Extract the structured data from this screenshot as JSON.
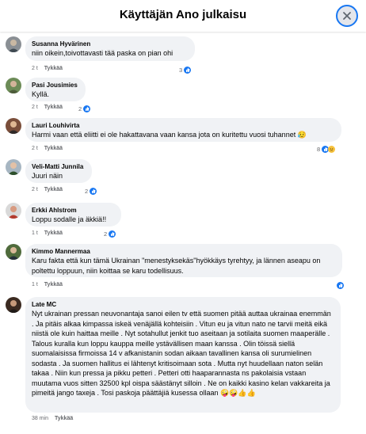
{
  "header": {
    "title": "Käyttäjän Ano julkaisu"
  },
  "comments": [
    {
      "author": "Susanna Hyvärinen",
      "text": "niin oikein,toivottavasti tää paska on pian ohi",
      "time": "2 t",
      "like": "Tykkää",
      "reactions": "3"
    },
    {
      "author": "Pasi Jousimies",
      "text": "Kyllä.",
      "time": "2 t",
      "like": "Tykkää",
      "reactions": "2"
    },
    {
      "author": "Lauri Louhivirta",
      "text": "Harmi vaan että eliitti ei ole hakattavana vaan kansa jota on kuritettu vuosi tuhannet 😥",
      "time": "2 t",
      "like": "Tykkää",
      "reactions": "8"
    },
    {
      "author": "Veli-Matti Junnila",
      "text": "Juuri näin",
      "time": "2 t",
      "like": "Tykkää",
      "reactions": "2"
    },
    {
      "author": "Erkki Ahlstrom",
      "text": "Loppu sodalle ja äkkiä!!",
      "time": "1 t",
      "like": "Tykkää",
      "reactions": "2"
    },
    {
      "author": "Kimmo Mannermaa",
      "text": "Karu fakta että kun tämä Ukrainan \"menestyksekäs\"hyökkäys tyrehtyy, ja lännen aseapu on poltettu loppuun, niin koittaa se karu todellisuus.",
      "time": "1 t",
      "like": "Tykkää",
      "reactions": ""
    },
    {
      "author": "Late MC",
      "text": "Nyt ukrainan pressan neuvonantaja sanoi eilen tv että suomen pitää auttaa ukrainaa enemmän . Ja pitäis alkaa kimpassa iskeä venäjällä kohteisiin . Vitun eu ja vitun nato ne tarvii meitä eikä niistä ole kuin haittaa meille . Nyt sotahullut jenkit tuo aseitaan ja sotilaita suomen maaperälle . Talous kuralla kun loppu kauppa meille ystävällisen maan kanssa . Olin töissä siellä suomalaisissa firmoissa 14 v afkanistanin sodan aikaan tavallinen kansa oli surumielinen sodasta . Ja suomen hallitus ei lähtenyt kritisoimaan sota . Mutta nyt huudellaan naton selän takaa . Niin kun pressa ja pikku petteri . Petteri otti haaparannasta ns pakolaisia vstaan muutama vuos sitten 32500 kpl oispa säästänyt silloin . Ne on kaikki kasino kelan vakkareita ja pimeitä jango taxeja . Tosi paskoja päättäjiä kusessa ollaan 🤪🤪👍👍",
      "time": "38 min",
      "like": "Tykkää",
      "reactions": ""
    }
  ]
}
